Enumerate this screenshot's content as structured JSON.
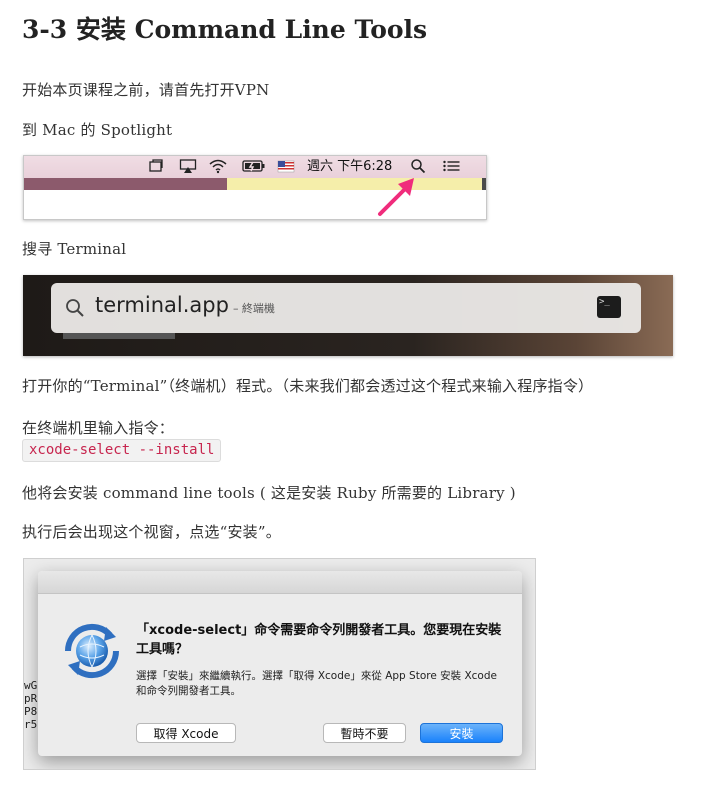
{
  "title": "3-3 安装 Command Line Tools",
  "paragraphs": {
    "p1": "开始本页课程之前，请首先打开VPN",
    "p2": "到 Mac 的 Spotlight",
    "p3": "搜寻 Terminal",
    "p4": "打开你的“Terminal”（终端机）程式。（未来我们都会透过这个程式来输入程序指令）",
    "p5": "在终端机里输入指令：",
    "p6": "他将会安装 command line tools ( 这是安装 Ruby 所需要的 Library )",
    "p7": "执行后会出现这个视窗，点选“安装”。"
  },
  "code": "xcode-select --install",
  "menubar": {
    "clock": "週六 下午6:28",
    "icons": [
      "window-icon",
      "airplay-icon",
      "wifi-icon",
      "battery-icon",
      "flag-icon",
      "spotlight-search-icon",
      "notification-list-icon"
    ],
    "arrow_color": "#f02c7c"
  },
  "spotlight": {
    "query": "terminal.app",
    "hint": "– 終端機"
  },
  "dialog": {
    "message": "「xcode-select」命令需要命令列開發者工具。您要現在安裝工具嗎？",
    "informative": "選擇「安裝」來繼續執行。選擇「取得 Xcode」來從 App Store 安裝 Xcode 和命令列開發者工具。",
    "buttons": {
      "get_xcode": "取得 Xcode",
      "not_now": "暫時不要",
      "install": "安裝"
    },
    "background_text": [
      "wG",
      "pR",
      "P8",
      "r5"
    ]
  }
}
